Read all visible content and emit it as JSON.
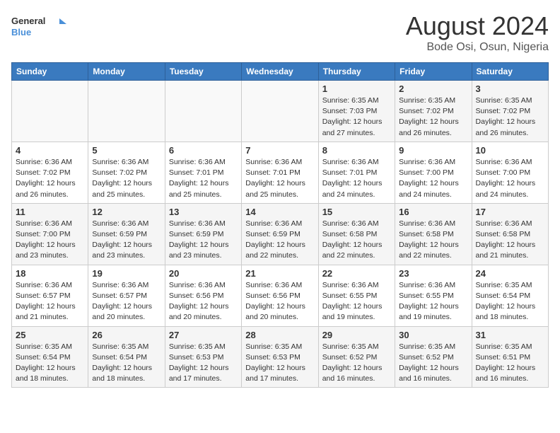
{
  "header": {
    "logo_line1": "General",
    "logo_line2": "Blue",
    "title": "August 2024",
    "subtitle": "Bode Osi, Osun, Nigeria"
  },
  "weekdays": [
    "Sunday",
    "Monday",
    "Tuesday",
    "Wednesday",
    "Thursday",
    "Friday",
    "Saturday"
  ],
  "weeks": [
    [
      {
        "day": "",
        "info": ""
      },
      {
        "day": "",
        "info": ""
      },
      {
        "day": "",
        "info": ""
      },
      {
        "day": "",
        "info": ""
      },
      {
        "day": "1",
        "info": "Sunrise: 6:35 AM\nSunset: 7:03 PM\nDaylight: 12 hours\nand 27 minutes."
      },
      {
        "day": "2",
        "info": "Sunrise: 6:35 AM\nSunset: 7:02 PM\nDaylight: 12 hours\nand 26 minutes."
      },
      {
        "day": "3",
        "info": "Sunrise: 6:35 AM\nSunset: 7:02 PM\nDaylight: 12 hours\nand 26 minutes."
      }
    ],
    [
      {
        "day": "4",
        "info": "Sunrise: 6:36 AM\nSunset: 7:02 PM\nDaylight: 12 hours\nand 26 minutes."
      },
      {
        "day": "5",
        "info": "Sunrise: 6:36 AM\nSunset: 7:02 PM\nDaylight: 12 hours\nand 25 minutes."
      },
      {
        "day": "6",
        "info": "Sunrise: 6:36 AM\nSunset: 7:01 PM\nDaylight: 12 hours\nand 25 minutes."
      },
      {
        "day": "7",
        "info": "Sunrise: 6:36 AM\nSunset: 7:01 PM\nDaylight: 12 hours\nand 25 minutes."
      },
      {
        "day": "8",
        "info": "Sunrise: 6:36 AM\nSunset: 7:01 PM\nDaylight: 12 hours\nand 24 minutes."
      },
      {
        "day": "9",
        "info": "Sunrise: 6:36 AM\nSunset: 7:00 PM\nDaylight: 12 hours\nand 24 minutes."
      },
      {
        "day": "10",
        "info": "Sunrise: 6:36 AM\nSunset: 7:00 PM\nDaylight: 12 hours\nand 24 minutes."
      }
    ],
    [
      {
        "day": "11",
        "info": "Sunrise: 6:36 AM\nSunset: 7:00 PM\nDaylight: 12 hours\nand 23 minutes."
      },
      {
        "day": "12",
        "info": "Sunrise: 6:36 AM\nSunset: 6:59 PM\nDaylight: 12 hours\nand 23 minutes."
      },
      {
        "day": "13",
        "info": "Sunrise: 6:36 AM\nSunset: 6:59 PM\nDaylight: 12 hours\nand 23 minutes."
      },
      {
        "day": "14",
        "info": "Sunrise: 6:36 AM\nSunset: 6:59 PM\nDaylight: 12 hours\nand 22 minutes."
      },
      {
        "day": "15",
        "info": "Sunrise: 6:36 AM\nSunset: 6:58 PM\nDaylight: 12 hours\nand 22 minutes."
      },
      {
        "day": "16",
        "info": "Sunrise: 6:36 AM\nSunset: 6:58 PM\nDaylight: 12 hours\nand 22 minutes."
      },
      {
        "day": "17",
        "info": "Sunrise: 6:36 AM\nSunset: 6:58 PM\nDaylight: 12 hours\nand 21 minutes."
      }
    ],
    [
      {
        "day": "18",
        "info": "Sunrise: 6:36 AM\nSunset: 6:57 PM\nDaylight: 12 hours\nand 21 minutes."
      },
      {
        "day": "19",
        "info": "Sunrise: 6:36 AM\nSunset: 6:57 PM\nDaylight: 12 hours\nand 20 minutes."
      },
      {
        "day": "20",
        "info": "Sunrise: 6:36 AM\nSunset: 6:56 PM\nDaylight: 12 hours\nand 20 minutes."
      },
      {
        "day": "21",
        "info": "Sunrise: 6:36 AM\nSunset: 6:56 PM\nDaylight: 12 hours\nand 20 minutes."
      },
      {
        "day": "22",
        "info": "Sunrise: 6:36 AM\nSunset: 6:55 PM\nDaylight: 12 hours\nand 19 minutes."
      },
      {
        "day": "23",
        "info": "Sunrise: 6:36 AM\nSunset: 6:55 PM\nDaylight: 12 hours\nand 19 minutes."
      },
      {
        "day": "24",
        "info": "Sunrise: 6:35 AM\nSunset: 6:54 PM\nDaylight: 12 hours\nand 18 minutes."
      }
    ],
    [
      {
        "day": "25",
        "info": "Sunrise: 6:35 AM\nSunset: 6:54 PM\nDaylight: 12 hours\nand 18 minutes."
      },
      {
        "day": "26",
        "info": "Sunrise: 6:35 AM\nSunset: 6:54 PM\nDaylight: 12 hours\nand 18 minutes."
      },
      {
        "day": "27",
        "info": "Sunrise: 6:35 AM\nSunset: 6:53 PM\nDaylight: 12 hours\nand 17 minutes."
      },
      {
        "day": "28",
        "info": "Sunrise: 6:35 AM\nSunset: 6:53 PM\nDaylight: 12 hours\nand 17 minutes."
      },
      {
        "day": "29",
        "info": "Sunrise: 6:35 AM\nSunset: 6:52 PM\nDaylight: 12 hours\nand 16 minutes."
      },
      {
        "day": "30",
        "info": "Sunrise: 6:35 AM\nSunset: 6:52 PM\nDaylight: 12 hours\nand 16 minutes."
      },
      {
        "day": "31",
        "info": "Sunrise: 6:35 AM\nSunset: 6:51 PM\nDaylight: 12 hours\nand 16 minutes."
      }
    ]
  ]
}
